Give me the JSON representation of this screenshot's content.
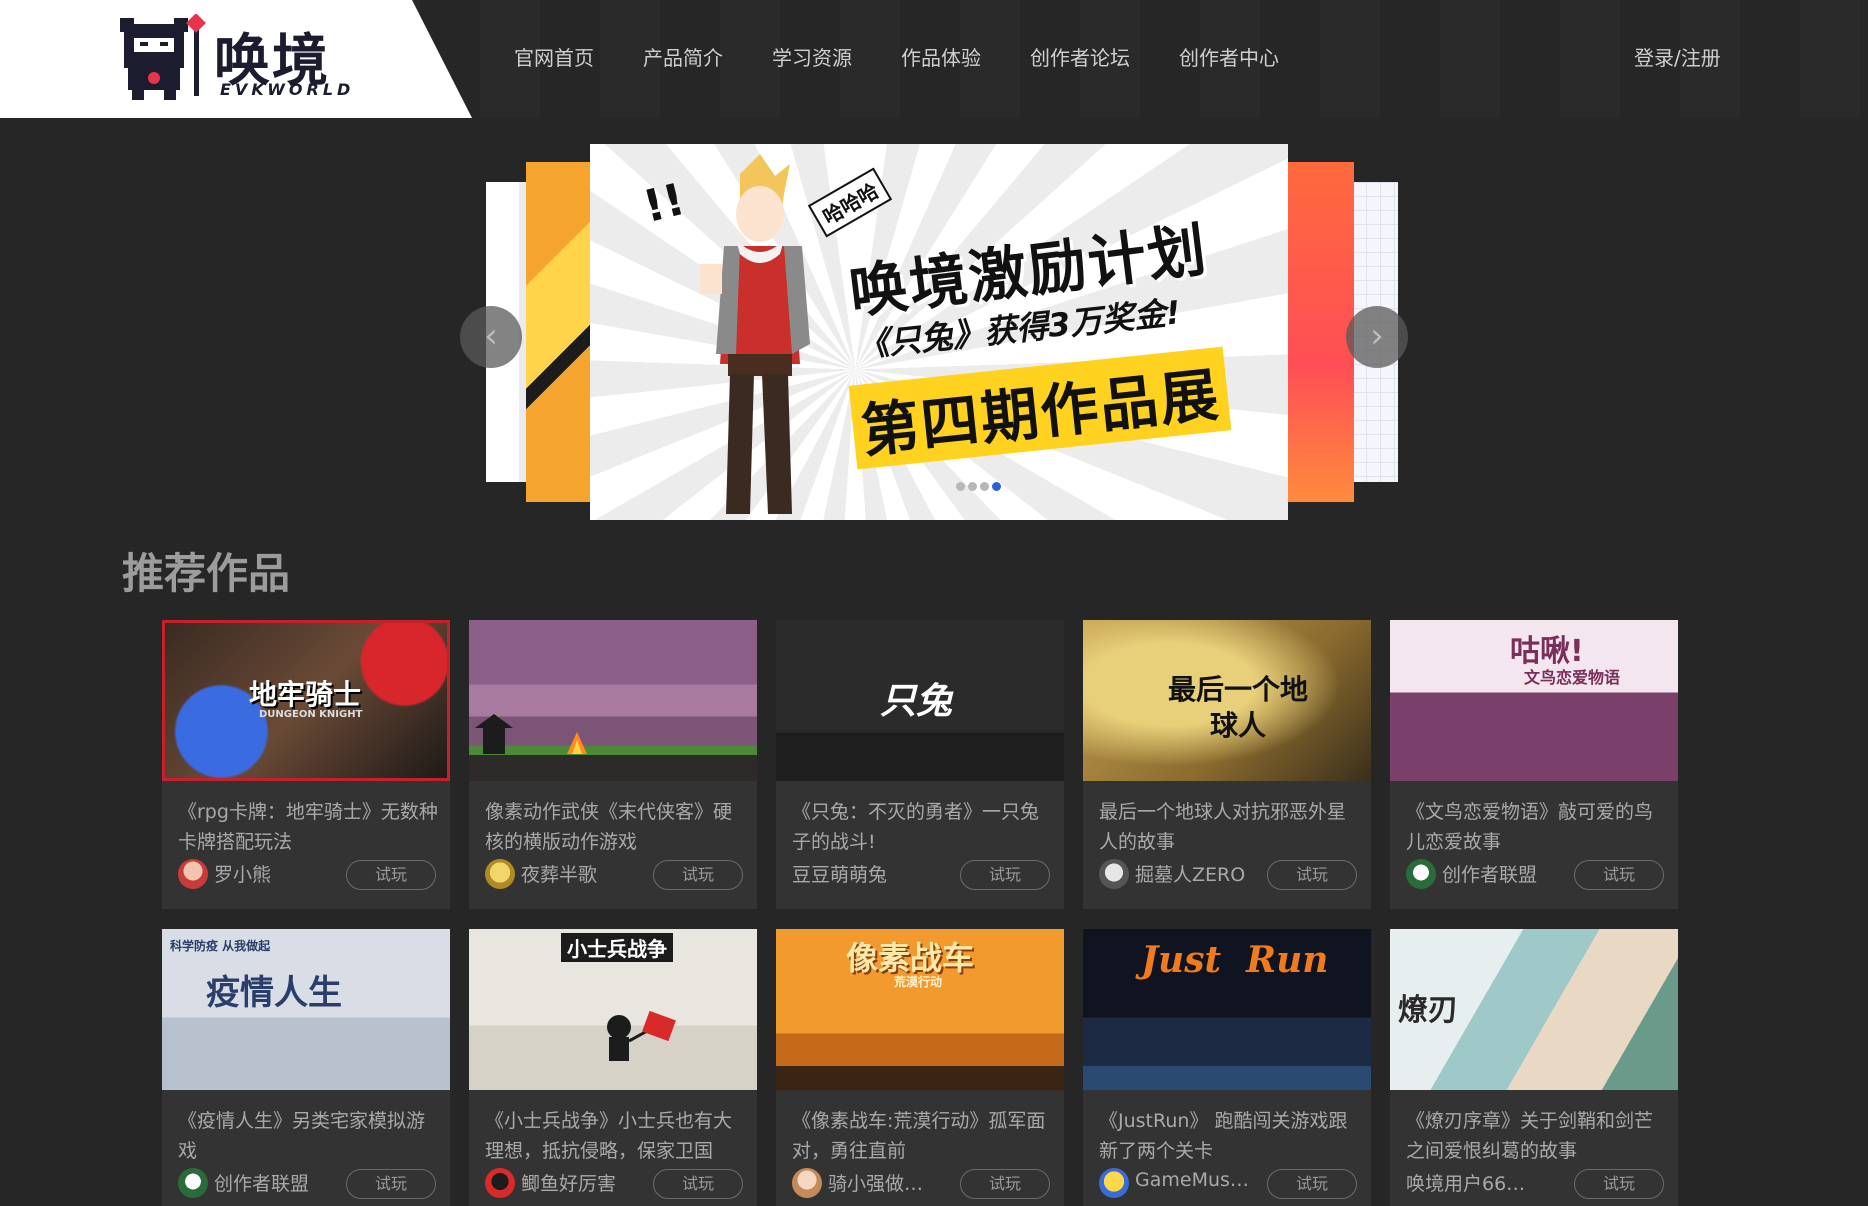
{
  "header": {
    "logo_cn": "唤境",
    "logo_en": "EVKWORLD",
    "nav": [
      "官网首页",
      "产品简介",
      "学习资源",
      "作品体验",
      "创作者论坛",
      "创作者中心"
    ],
    "login": "登录/注册"
  },
  "banner": {
    "exclaim": "!!",
    "badge": "哈哈哈",
    "title": "唤境激励计划",
    "subtitle": "《只兔》获得3万奖金!",
    "footer": "第四期作品展",
    "dots_total": 4,
    "dot_active": 4,
    "prev_icon": "‹",
    "next_icon": "›"
  },
  "section": {
    "title": "推荐作品"
  },
  "games": [
    {
      "thumb_text": "地牢骑士",
      "thumb_sub": "DUNGEON KNIGHT",
      "desc": "《rpg卡牌：地牢骑士》无数种卡牌搭配玩法",
      "author": "罗小熊",
      "try": "试玩"
    },
    {
      "thumb_text": "",
      "thumb_sub": "",
      "desc": "像素动作武侠《末代侠客》硬核的横版动作游戏",
      "author": "夜葬半歌",
      "try": "试玩"
    },
    {
      "thumb_text": "只兔",
      "thumb_sub": "",
      "desc": "《只兔：不灭的勇者》一只兔子的战斗!",
      "author": "豆豆萌萌兔",
      "try": "试玩"
    },
    {
      "thumb_text": "最后一个地球人",
      "thumb_sub": "",
      "desc": "最后一个地球人对抗邪恶外星人的故事",
      "author": "掘墓人ZERO",
      "try": "试玩"
    },
    {
      "thumb_text": "咕啾!",
      "thumb_sub": "文鸟恋爱物语",
      "desc": "《文鸟恋爱物语》敲可爱的鸟儿恋爱故事",
      "author": "创作者联盟",
      "try": "试玩"
    },
    {
      "thumb_text": "疫情人生",
      "thumb_sub": "科学防疫 从我做起",
      "desc": "《疫情人生》另类宅家模拟游戏",
      "author": "创作者联盟",
      "try": "试玩"
    },
    {
      "thumb_text": "小士兵战争",
      "thumb_sub": "",
      "desc": "《小士兵战争》小士兵也有大理想，抵抗侵略，保家卫国",
      "author": "鲫鱼好厉害",
      "try": "试玩"
    },
    {
      "thumb_text": "像素战车",
      "thumb_sub": "荒漠行动",
      "desc": "《像素战车:荒漠行动》孤军面对，勇往直前",
      "author": "骑小强做…",
      "try": "试玩"
    },
    {
      "thumb_text": "Just  Run",
      "thumb_sub": "",
      "desc": "《JustRun》 跑酷闯关游戏跟新了两个关卡",
      "author": "GameMus…",
      "try": "试玩"
    },
    {
      "thumb_text": "燎刃",
      "thumb_sub": "",
      "desc": "《燎刃序章》关于剑鞘和剑芒之间爱恨纠葛的故事",
      "author": "唤境用户66…",
      "try": "试玩"
    }
  ],
  "colors": {
    "background": "#262626",
    "card": "#333333",
    "accent_dot": "#2c5fd8",
    "banner_yellow": "#ffd21f"
  }
}
